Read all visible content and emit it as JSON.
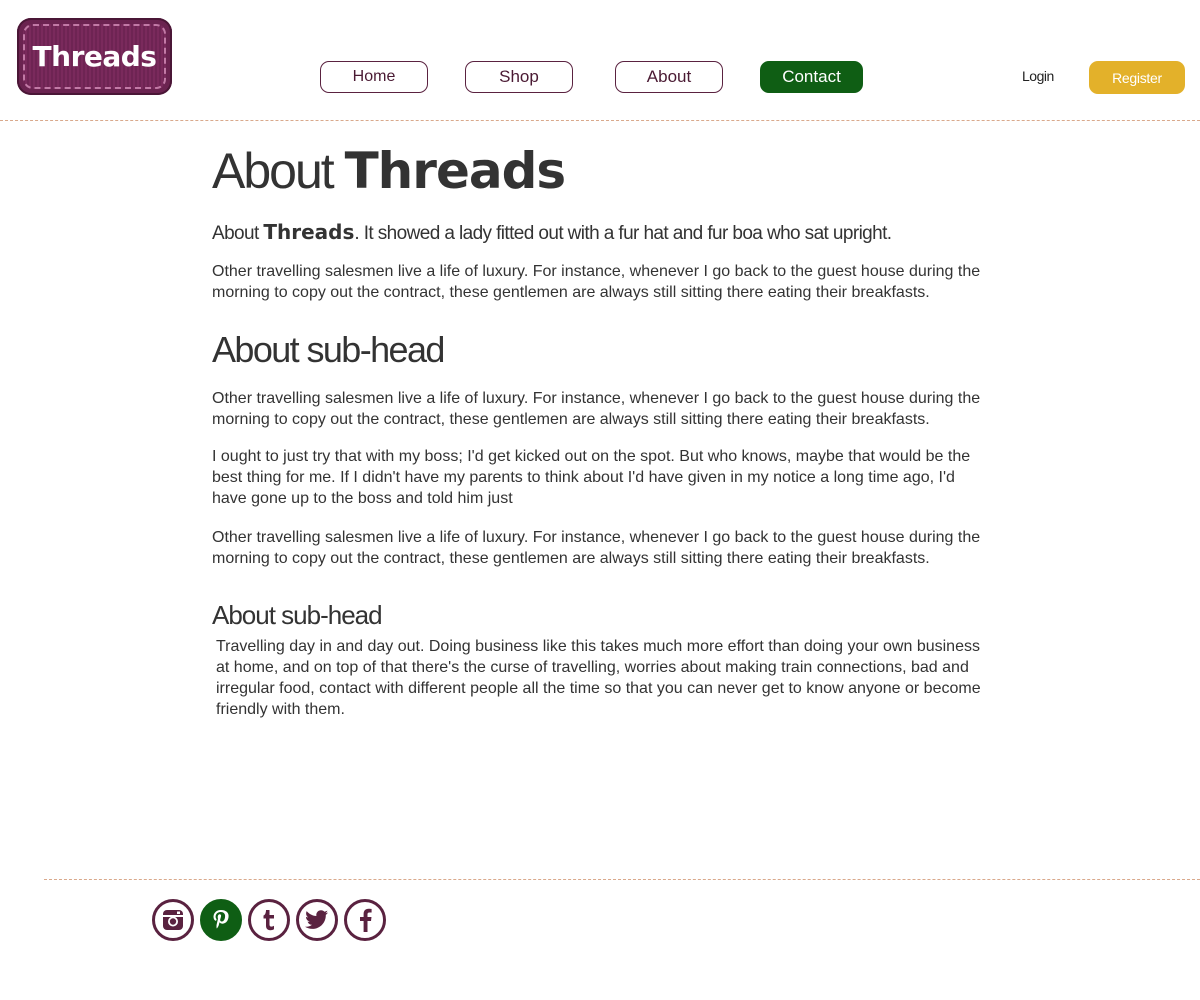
{
  "header": {
    "logo_text": "Threads",
    "nav": {
      "home": "Home",
      "shop": "Shop",
      "about": "About",
      "contact": "Contact"
    },
    "login_label": "Login",
    "register_label": "Register"
  },
  "main": {
    "title_prefix": "About",
    "title_brand": "Threads",
    "intro_prefix": "About",
    "intro_brand": "Threads",
    "intro_suffix": ". It showed a lady fitted out with a fur hat and fur boa who sat upright.",
    "paragraph_1": "Other travelling salesmen live a life of luxury. For instance, whenever I go back to the guest house during the morning to copy out the contract, these gentlemen are always still sitting there eating their breakfasts.",
    "subhead_1": "About sub-head",
    "paragraph_2": "Other travelling salesmen live a life of luxury. For instance, whenever I go back to the guest house during the morning to copy out the contract, these gentlemen are always still sitting there eating their breakfasts.",
    "paragraph_3": "I ought to just try that with my boss; I'd get kicked out on the spot. But who knows, maybe that would be the best thing for me. If I didn't have my parents to think about I'd have given in my notice a long time ago, I'd have gone up to the boss and told him just",
    "paragraph_4": "Other travelling salesmen live a life of luxury. For instance, whenever I go back to the guest house during the morning to copy out the contract, these gentlemen are always still sitting there eating their breakfasts.",
    "subhead_2": "About sub-head",
    "paragraph_5": "Travelling day in and day out. Doing business like this takes much more effort than doing your own business at home, and on top of that there's the curse of travelling, worries about making train connections, bad and irregular food, contact with different people all the time so that you can never get to know anyone or become friendly with them."
  },
  "footer": {
    "social_icons": [
      "instagram-icon",
      "pinterest-icon",
      "tumblr-icon",
      "twitter-icon",
      "facebook-icon"
    ]
  },
  "colors": {
    "brand_plum": "#6b2350",
    "accent_green": "#0f5e14",
    "accent_gold": "#e3b12a",
    "text": "#333333",
    "divider": "#d9a98c"
  }
}
